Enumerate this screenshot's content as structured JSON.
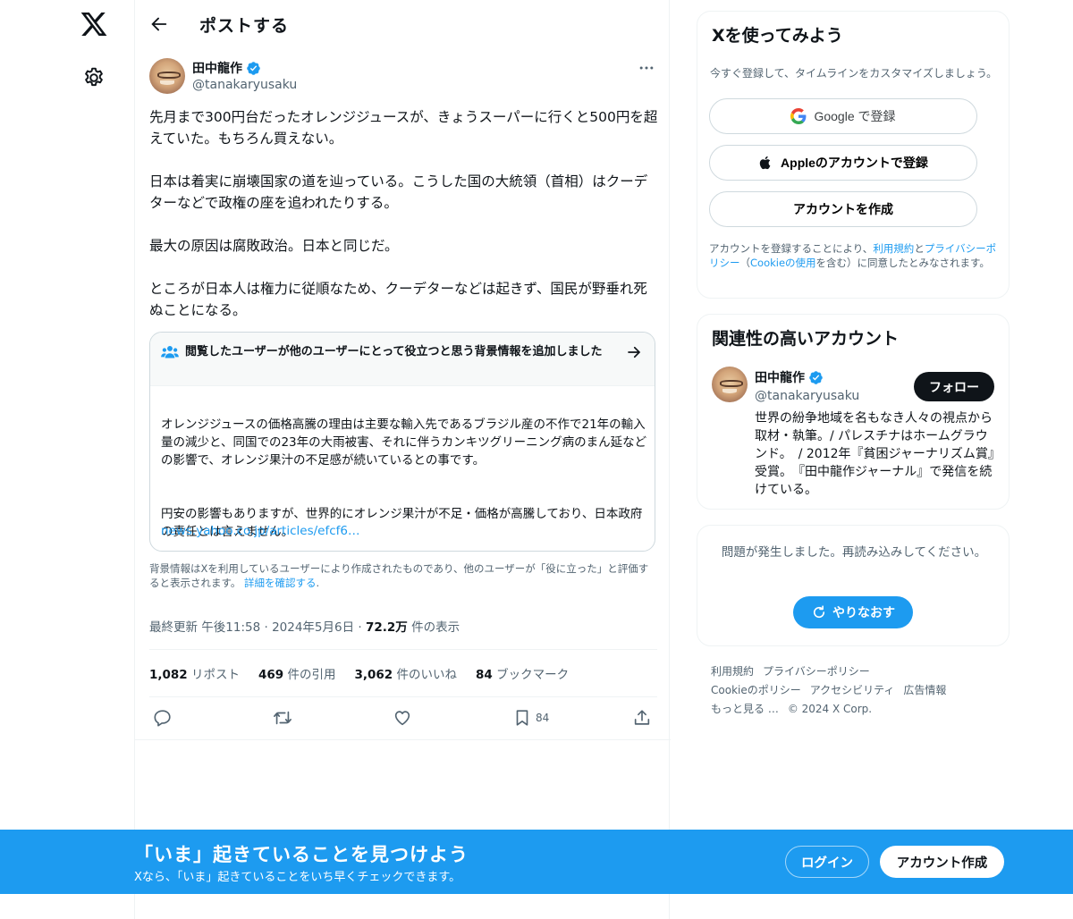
{
  "header": {
    "title": "ポストする"
  },
  "tweet": {
    "author_name": "田中龍作",
    "author_handle": "@tanakaryusaku",
    "paragraphs": [
      "先月まで300円台だったオレンジジュースが、きょうスーパーに行くと500円を超えていた。もちろん買えない。",
      "日本は着実に崩壊国家の道を辿っている。こうした国の大統領（首相）はクーデターなどで政権の座を追われたりする。",
      "最大の原因は腐敗政治。日本と同じだ。",
      "ところが日本人は権力に従順なため、クーデターなどは起きず、国民が野垂れ死ぬことになる。"
    ],
    "note": {
      "title": "閲覧したユーザーが他のユーザーにとって役立つと思う背景情報を追加しました",
      "paragraph1": "オレンジジュースの価格高騰の理由は主要な輸入先であるブラジル産の不作で21年の輸入量の減少と、同国での23年の大雨被害、それに伴うカンキツグリーニング病のまん延などの影響で、オレンジ果汁の不足感が続いているとの事です。",
      "paragraph2": "円安の影響もありますが、世界的にオレンジ果汁が不足・価格が高騰しており、日本政府の責任とは言えません。",
      "link": "news.yahoo.co.jp/articles/efcf6…"
    },
    "note_footer": "背景情報はXを利用しているユーザーにより作成されたものであり、他のユーザーが「役に立った」と評価すると表示されます。",
    "note_footer_link": "詳細を確認する",
    "meta": {
      "updated": "最終更新 午後11:58 · 2024年5月6日 · ",
      "views_count": "72.2万",
      "views_label": " 件の表示"
    },
    "stats": [
      {
        "count": "1,082",
        "label": " リポスト"
      },
      {
        "count": "469",
        "label": " 件の引用"
      },
      {
        "count": "3,062",
        "label": " 件のいいね"
      },
      {
        "count": "84",
        "label": " ブックマーク"
      }
    ],
    "bookmark_count": "84"
  },
  "signup": {
    "title": "Xを使ってみよう",
    "subtitle": "今すぐ登録して、タイムラインをカスタマイズしましょう。",
    "google_label": "Google で登録",
    "apple_label": "Appleのアカウントで登録",
    "create_label": "アカウントを作成",
    "legal_prefix": "アカウントを登録することにより、",
    "terms_link": "利用規約",
    "legal_and": "と",
    "privacy_link": "プライバシーポリシー",
    "legal_paren_open": "（",
    "cookie_link": "Cookieの使用",
    "legal_suffix": "を含む）に同意したとみなされます。"
  },
  "related": {
    "title": "関連性の高いアカウント",
    "name": "田中龍作",
    "handle": "@tanakaryusaku",
    "follow_label": "フォロー",
    "bio": "世界の紛争地域を名もなき人々の視点から取材・執筆。/ パレスチナはホームグラウンド。　/ 2012年『貧困ジャーナリズム賞』受賞。　『田中龍作ジャーナル』で発信を続けている。"
  },
  "error": {
    "message": "問題が発生しました。再読み込みしてください。",
    "retry_label": "やりなおす"
  },
  "footer": {
    "links": [
      "利用規約",
      "プライバシーポリシー",
      "Cookieのポリシー",
      "アクセシビリティ",
      "広告情報",
      "もっと見る …",
      "© 2024 X Corp."
    ]
  },
  "banner": {
    "title": "「いま」起きていることを見つけよう",
    "subtitle": "Xなら、「いま」起きていることをいち早くチェックできます。",
    "login_label": "ログイン",
    "signup_label": "アカウント作成"
  },
  "colors": {
    "accent": "#1d9bf0",
    "text": "#0f1419",
    "muted": "#536471",
    "border": "#eff3f4"
  }
}
